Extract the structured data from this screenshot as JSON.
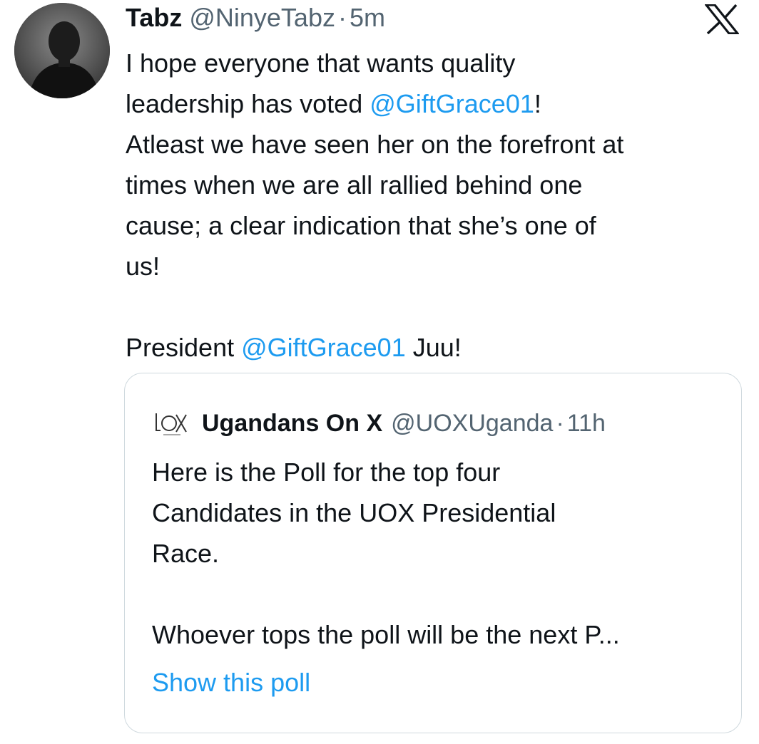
{
  "tweet": {
    "display_name": "Tabz",
    "handle": "@NinyeTabz",
    "separator": "·",
    "time": "5m",
    "logo_icon": "x-logo-icon",
    "avatar_icon": "avatar-photo",
    "text": {
      "line1": "I hope everyone that wants quality",
      "line2_prefix": "leadership has voted ",
      "line2_mention": "@GiftGrace01",
      "line2_suffix": "!",
      "line3": "Atleast we have seen her on the forefront at",
      "line4": "times when we are all rallied behind one",
      "line5": "cause; a clear indication that she’s one of",
      "line6": "us!",
      "line7_prefix": "President ",
      "line7_mention": "@GiftGrace01",
      "line7_suffix": " Juu!"
    }
  },
  "quote": {
    "logo_icon": "uox-logo-icon",
    "display_name": "Ugandans On X",
    "handle": "@UOXUganda",
    "separator": "·",
    "time": "11h",
    "text": {
      "line1": "Here is the Poll for the top four",
      "line2": "Candidates in the UOX Presidential",
      "line3": "Race.",
      "line4": "Whoever tops the poll will be the next P..."
    },
    "show_poll_label": "Show this poll"
  },
  "colors": {
    "link": "#1d9bf0",
    "secondary_text": "#536471",
    "primary_text": "#0f1419",
    "border": "#cfd9de"
  }
}
